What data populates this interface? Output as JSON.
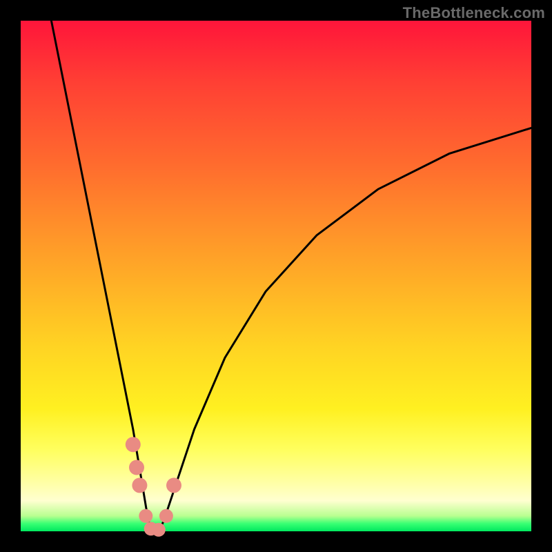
{
  "watermark": "TheBottleneck.com",
  "colors": {
    "frame": "#000000",
    "curve_stroke": "#000000",
    "marker_fill": "#e98b83",
    "marker_stroke": "#c96a62"
  },
  "chart_data": {
    "type": "line",
    "title": "",
    "xlabel": "",
    "ylabel": "",
    "xlim": [
      0,
      100
    ],
    "ylim": [
      0,
      100
    ],
    "grid": false,
    "legend": false,
    "series": [
      {
        "name": "bottleneck-curve",
        "x": [
          6,
          8,
          10,
          12,
          14,
          16,
          18,
          20,
          22,
          24,
          25,
          26,
          27,
          28,
          30,
          34,
          40,
          48,
          58,
          70,
          84,
          100
        ],
        "y": [
          100,
          90,
          80,
          70,
          60,
          50,
          40,
          30,
          20,
          8,
          2,
          0,
          0,
          2,
          8,
          20,
          34,
          47,
          58,
          67,
          74,
          79
        ]
      }
    ],
    "markers": [
      {
        "x": 22.0,
        "y": 17.0
      },
      {
        "x": 22.7,
        "y": 12.5
      },
      {
        "x": 23.3,
        "y": 9.0
      },
      {
        "x": 24.5,
        "y": 3.0
      },
      {
        "x": 25.5,
        "y": 0.5
      },
      {
        "x": 27.0,
        "y": 0.3
      },
      {
        "x": 28.5,
        "y": 3.0
      },
      {
        "x": 30.0,
        "y": 9.0
      }
    ],
    "notch": {
      "x_min_frac": 0.24,
      "x_vertex_frac": 0.265,
      "depth_fraction_of_plot": 1.0
    }
  }
}
